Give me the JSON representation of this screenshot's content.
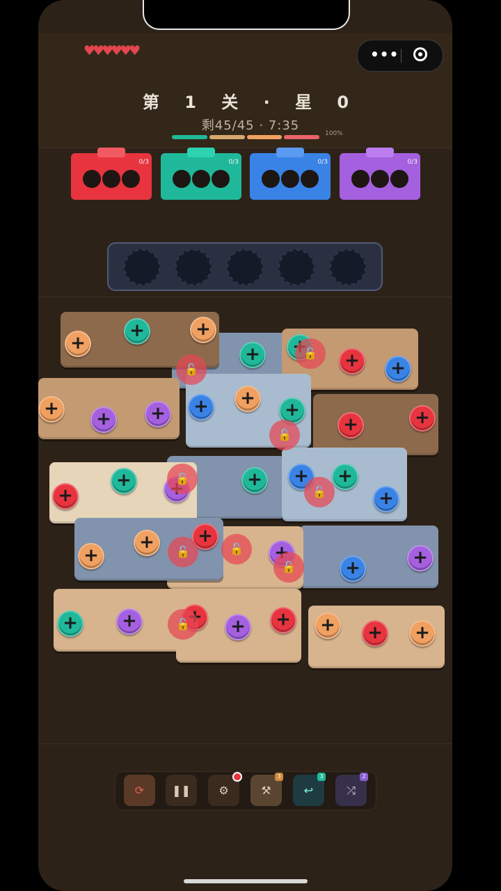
{
  "header": {
    "hearts": "♥♥♥♥♥♥",
    "title": "第 1 关 · 星 0",
    "remaining": "剩45/45 · 7:35",
    "percent": "100%",
    "capsule_more": "•••"
  },
  "progress_colors": [
    "#1fb89a",
    "#d7a86e",
    "#f0a060",
    "#e8646a"
  ],
  "crates": [
    {
      "color": "#e8343f",
      "lid": "#f25a63",
      "count": "0/3"
    },
    {
      "color": "#1fb89a",
      "lid": "#2dd3b1",
      "count": "0/3"
    },
    {
      "color": "#3a83e6",
      "lid": "#5a9af0",
      "count": "0/3"
    },
    {
      "color": "#a560e0",
      "lid": "#bb7df0",
      "count": "0/3"
    }
  ],
  "tray_slots": 5,
  "screw_colors": {
    "orange": "#f0a060",
    "teal": "#1fb89a",
    "purple": "#a560e0",
    "red": "#e8343f",
    "blue": "#3a83e6"
  },
  "toolbar": {
    "restart": "⟳",
    "pause": "❚❚",
    "settings": "⚙",
    "hammer": "⚒",
    "hammer_count": "3",
    "undo": "↩",
    "undo_count": "3",
    "shuffle": "⤮",
    "shuffle_count": "2"
  },
  "lock_icon": "🔓"
}
